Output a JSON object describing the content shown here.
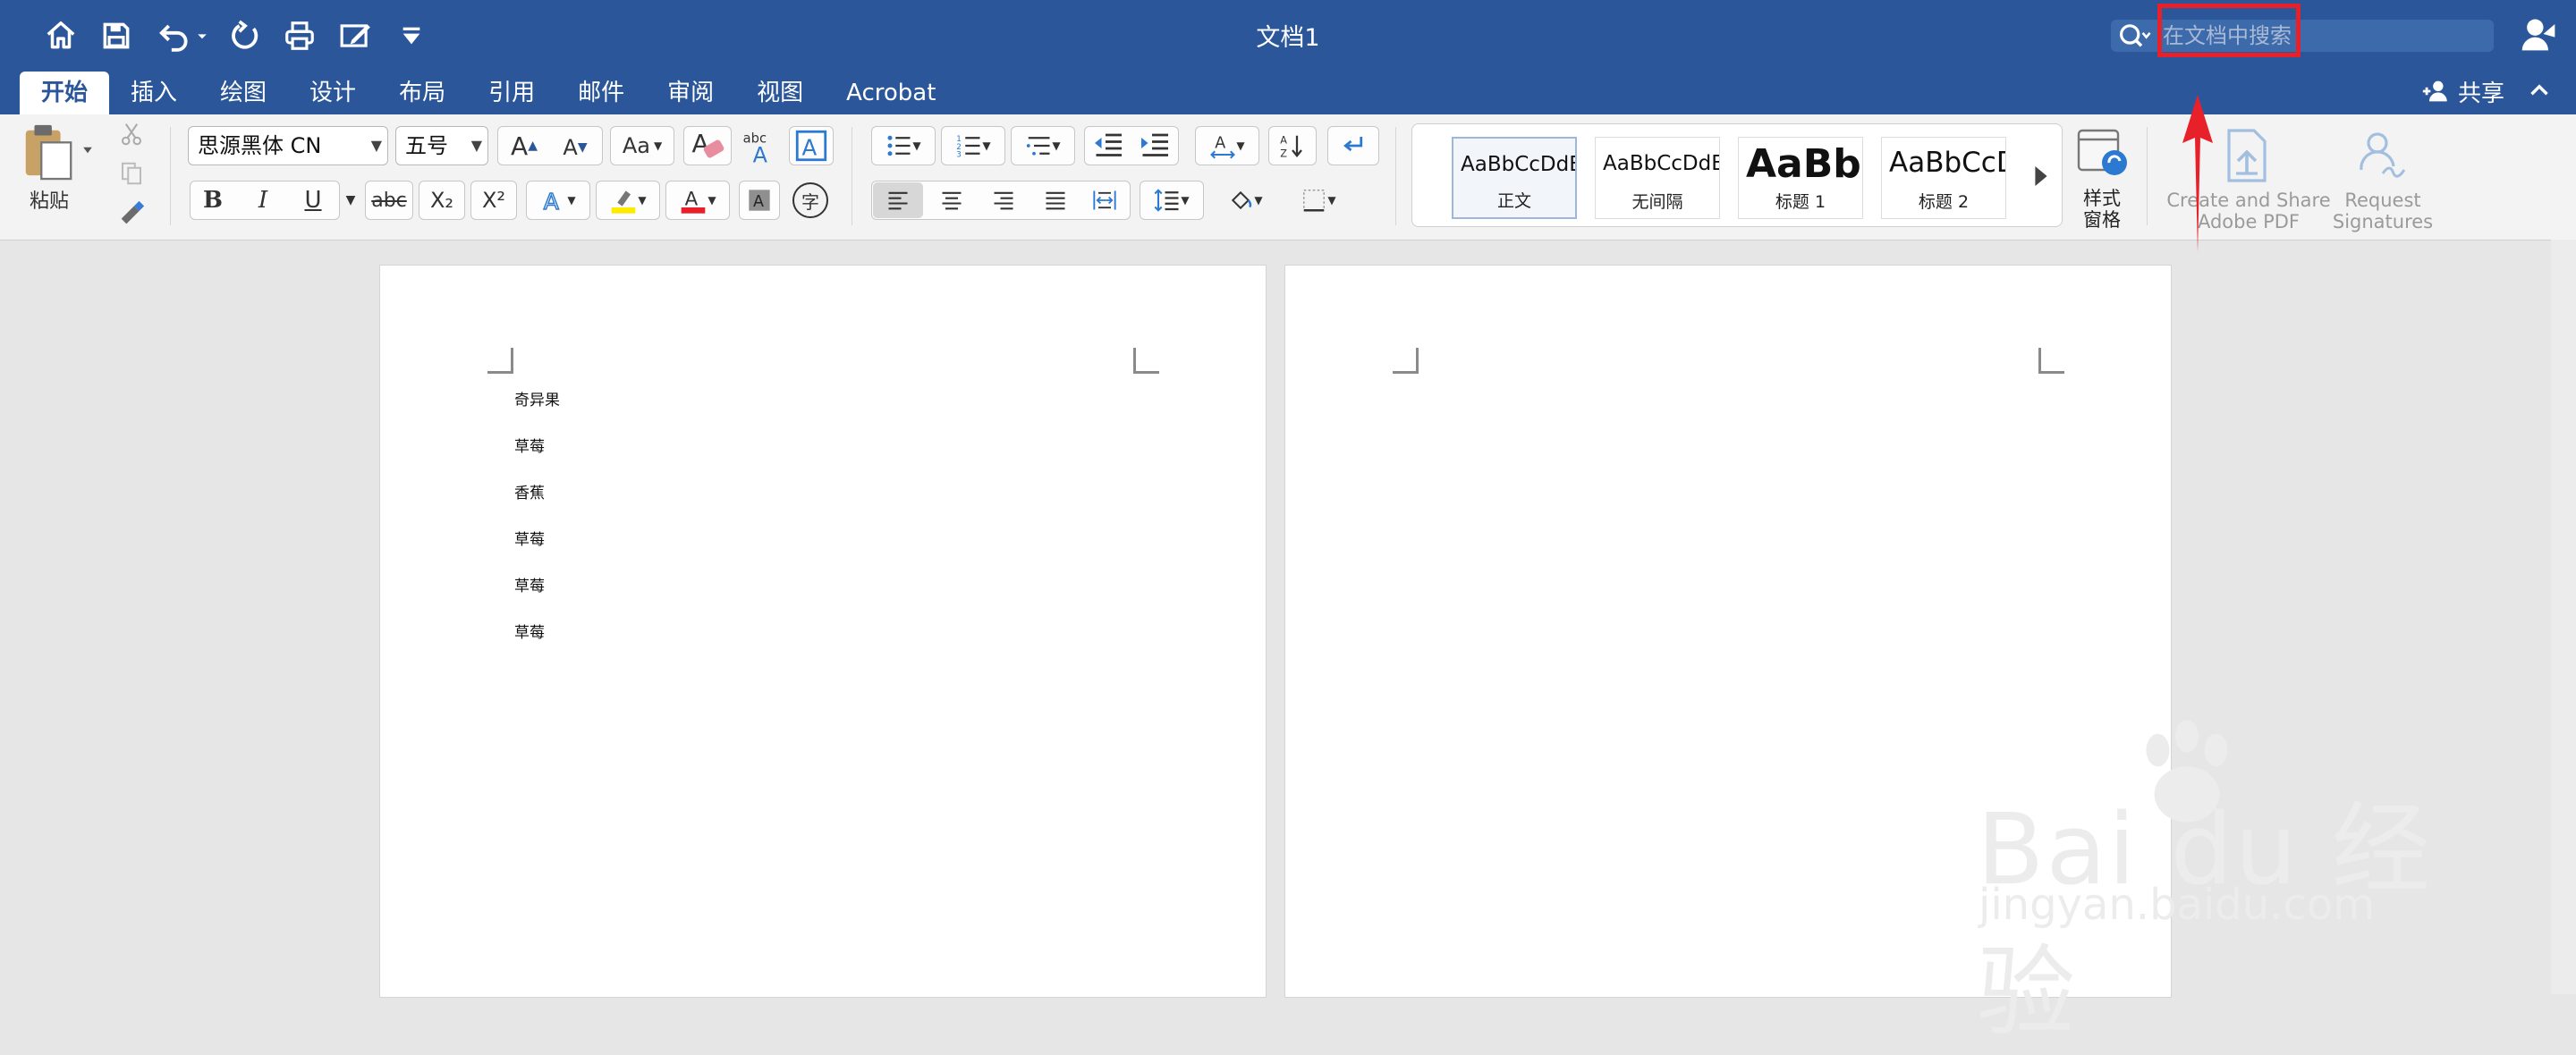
{
  "window": {
    "title": "文档1",
    "search_placeholder": "在文档中搜索"
  },
  "quick_access": [
    "home-icon",
    "save-icon",
    "undo-icon",
    "redo-icon",
    "print-icon",
    "edit-icon",
    "customize-icon"
  ],
  "tabs": [
    {
      "label": "开始",
      "active": true
    },
    {
      "label": "插入"
    },
    {
      "label": "绘图"
    },
    {
      "label": "设计"
    },
    {
      "label": "布局"
    },
    {
      "label": "引用"
    },
    {
      "label": "邮件"
    },
    {
      "label": "审阅"
    },
    {
      "label": "视图"
    },
    {
      "label": "Acrobat"
    }
  ],
  "share_label": "共享",
  "ribbon": {
    "paste_label": "粘贴",
    "font_name": "思源黑体 CN",
    "font_size": "五号",
    "bold": "B",
    "italic": "I",
    "underline": "U",
    "strike": "abc",
    "subscript": "X₂",
    "superscript": "X²",
    "phonetic": "字",
    "spell_abc": "abc",
    "styles": [
      {
        "preview": "AaBbCcDdEe",
        "label": "正文",
        "selected": true
      },
      {
        "preview": "AaBbCcDdEe",
        "label": "无间隔"
      },
      {
        "preview": "AaBb(",
        "label": "标题 1"
      },
      {
        "preview": "AaBbCcD",
        "label": "标题 2"
      }
    ],
    "styles_pane_label": "样式\n窗格",
    "create_pdf_label": "Create and Share\nAdobe PDF",
    "request_sig_label": "Request\nSignatures"
  },
  "document": {
    "page1_lines": [
      "奇异果",
      "草莓",
      "香蕉",
      "草莓",
      "草莓",
      "草莓"
    ]
  },
  "watermark": {
    "main": "Bai du 经验",
    "sub": "jingyan.baidu.com"
  },
  "colors": {
    "title_bar": "#2b579a",
    "highlight_box": "#e8202a",
    "arrow": "#e8202a"
  }
}
